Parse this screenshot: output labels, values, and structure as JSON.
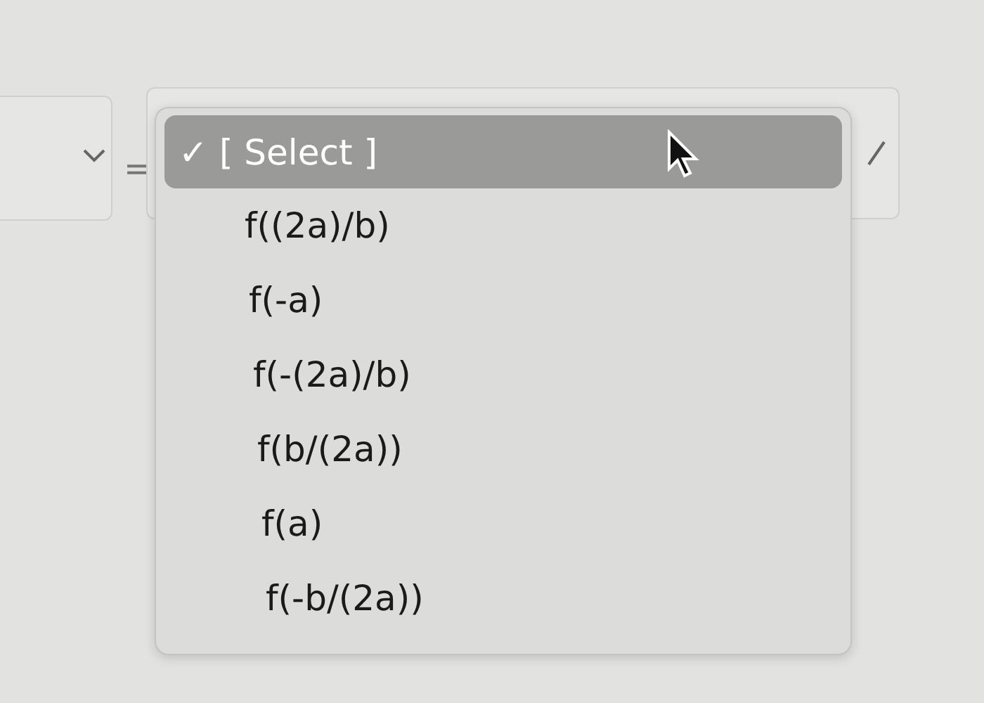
{
  "equals_sign": "=",
  "check_mark": "✓",
  "menu": {
    "items": [
      {
        "label": "[ Select ]",
        "selected": true
      },
      {
        "label": "f((2a)/b)",
        "selected": false
      },
      {
        "label": "f(-a)",
        "selected": false
      },
      {
        "label": "f(-(2a)/b)",
        "selected": false
      },
      {
        "label": "f(b/(2a))",
        "selected": false
      },
      {
        "label": "f(a)",
        "selected": false
      },
      {
        "label": "f(-b/(2a))",
        "selected": false
      }
    ]
  }
}
